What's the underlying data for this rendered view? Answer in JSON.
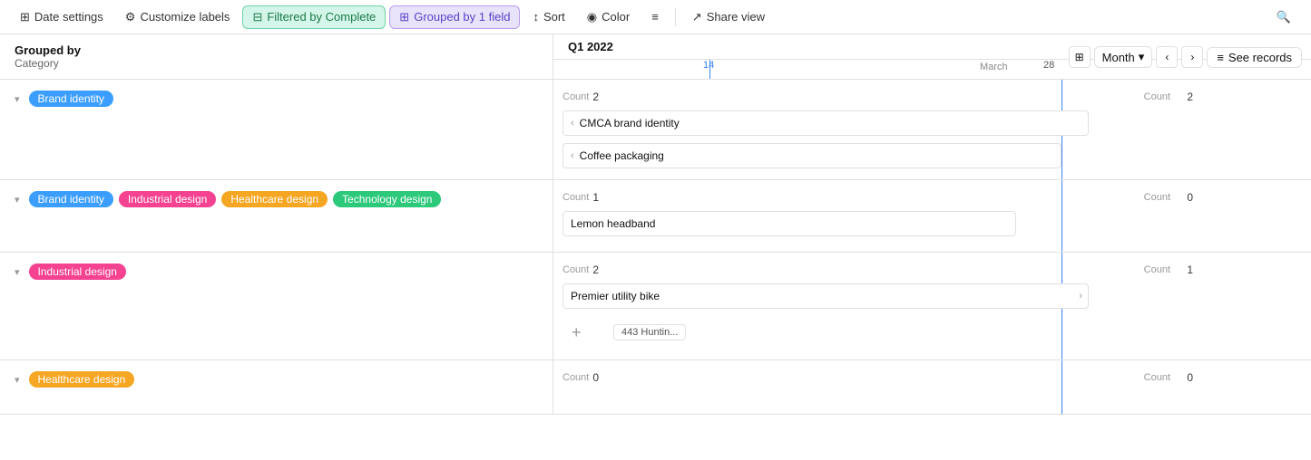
{
  "toolbar": {
    "date_settings": "Date settings",
    "customize_labels": "Customize labels",
    "filtered_by": "Filtered by Complete",
    "grouped_by": "Grouped by 1 field",
    "sort": "Sort",
    "color": "Color",
    "density": "≡",
    "share_view": "Share view",
    "search": "🔍"
  },
  "header": {
    "grouped_by_label": "Grouped by",
    "grouped_by_field": "Category",
    "quarter": "Q1 2022",
    "month_btn": "Month",
    "see_records": "See records",
    "march_label": "March",
    "date_14": "14",
    "date_28": "28"
  },
  "groups": [
    {
      "id": "brand-identity",
      "tags": [
        {
          "label": "Brand identity",
          "color": "blue"
        }
      ],
      "count_left_label": "Count",
      "count_left_val": "2",
      "count_right_label": "Count",
      "count_right_val": "2",
      "records": [
        {
          "label": "CMCA brand identity",
          "has_expand": false
        },
        {
          "label": "Coffee packaging",
          "has_expand": false
        }
      ],
      "add": false
    },
    {
      "id": "multi-tag",
      "tags": [
        {
          "label": "Brand identity",
          "color": "blue"
        },
        {
          "label": "Industrial design",
          "color": "pink"
        },
        {
          "label": "Healthcare design",
          "color": "orange"
        },
        {
          "label": "Technology design",
          "color": "green"
        }
      ],
      "count_left_label": "Count",
      "count_left_val": "1",
      "count_right_label": "Count",
      "count_right_val": "0",
      "records": [
        {
          "label": "Lemon headband",
          "has_expand": false
        }
      ],
      "add": false
    },
    {
      "id": "industrial-design",
      "tags": [
        {
          "label": "Industrial design",
          "color": "pink"
        }
      ],
      "count_left_label": "Count",
      "count_left_val": "2",
      "count_right_label": "Count",
      "count_right_val": "1",
      "records": [
        {
          "label": "Premier utility bike",
          "has_expand": true
        }
      ],
      "add": true,
      "partial": "443 Huntin..."
    },
    {
      "id": "healthcare-design",
      "tags": [
        {
          "label": "Healthcare design",
          "color": "orange"
        }
      ],
      "count_left_label": "Count",
      "count_left_val": "0",
      "count_right_label": "Count",
      "count_right_val": "0",
      "records": [],
      "add": false
    }
  ]
}
